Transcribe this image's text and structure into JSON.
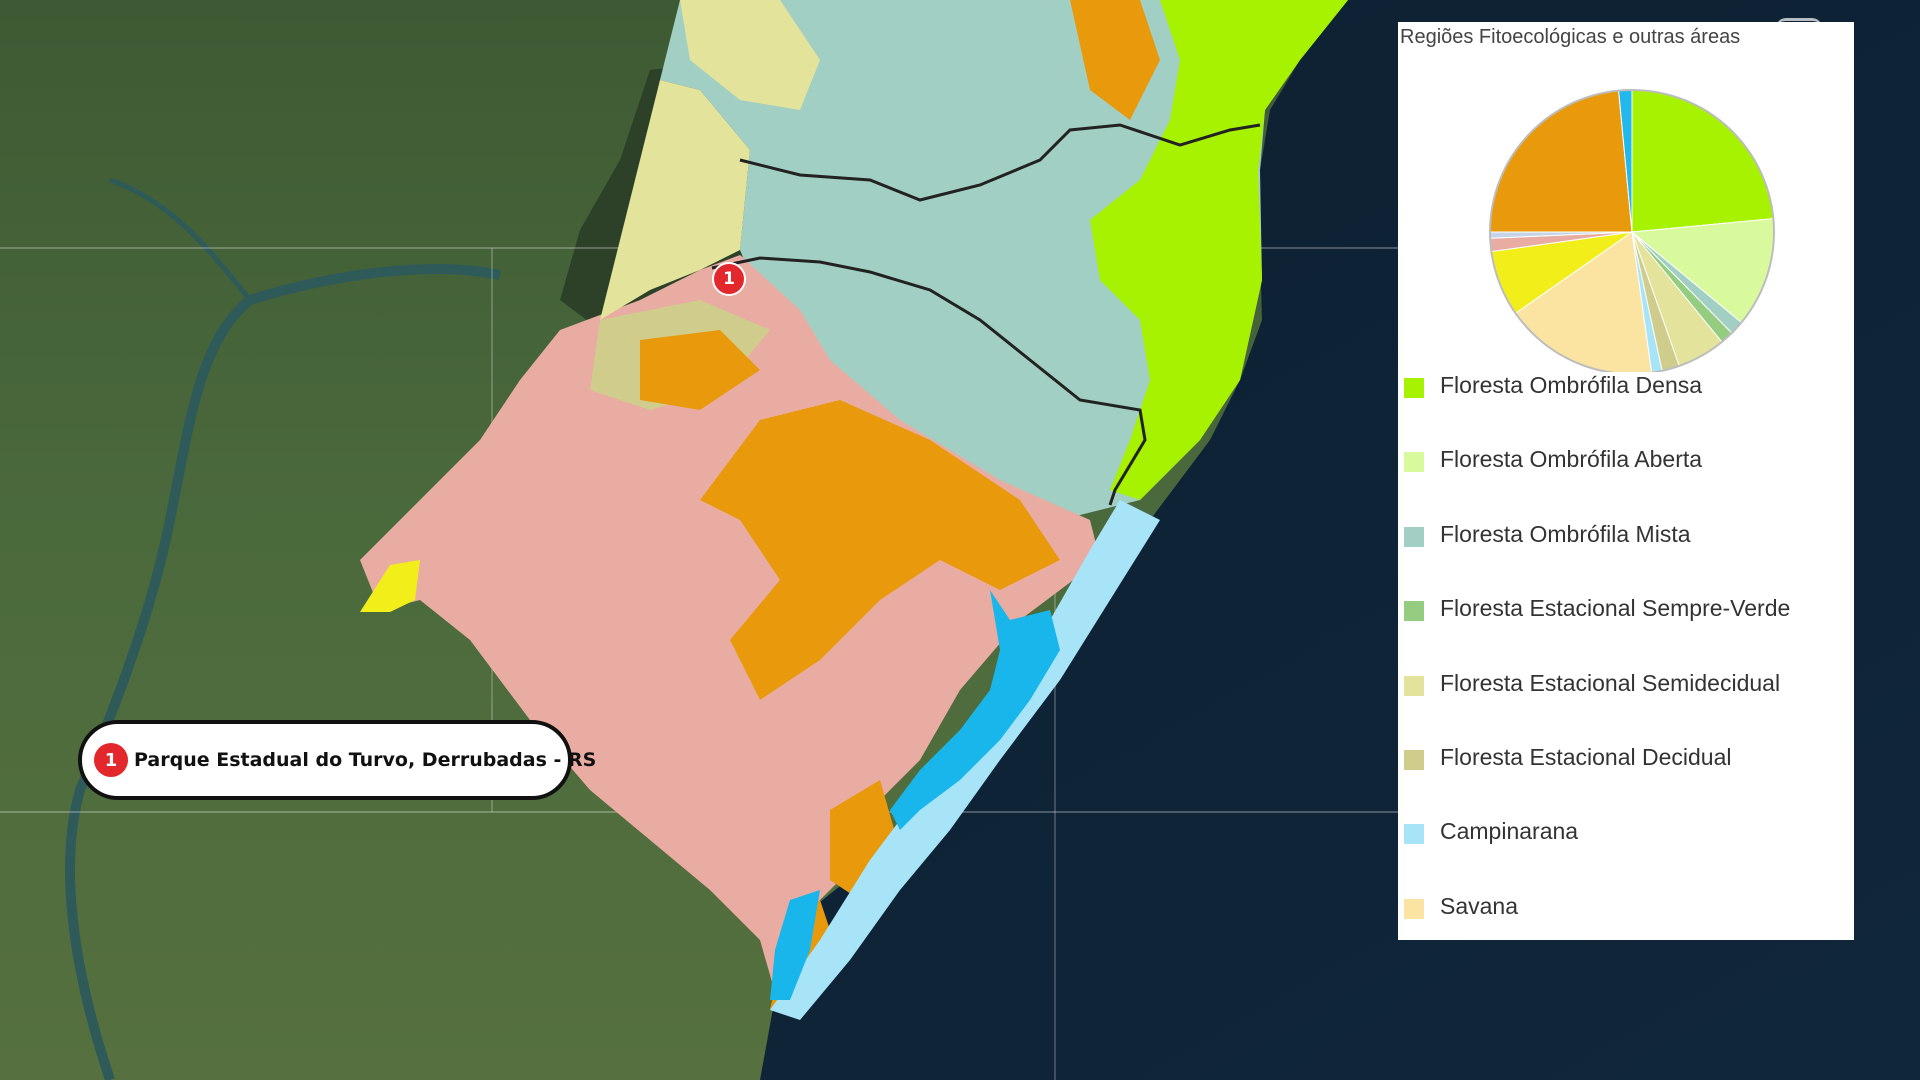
{
  "map": {
    "marker_label": "1",
    "callout": {
      "badge": "1",
      "text": "Parque Estadual do Turvo, Derrubadas - RS"
    }
  },
  "legend": {
    "title": "Regiões Fitoecológicas e outras áreas",
    "items": [
      {
        "label": "Floresta Ombrófila Densa",
        "color": "#a6f200"
      },
      {
        "label": "Floresta Ombrófila Aberta",
        "color": "#d9fa9c"
      },
      {
        "label": "Floresta Ombrófila Mista",
        "color": "#a2cfc3"
      },
      {
        "label": "Floresta Estacional Sempre-Verde",
        "color": "#94cc80"
      },
      {
        "label": "Floresta Estacional Semidecidual",
        "color": "#e3e39c"
      },
      {
        "label": "Floresta Estacional Decidual",
        "color": "#cfcc8c"
      },
      {
        "label": "Campinarana",
        "color": "#a8e4f8"
      },
      {
        "label": "Savana",
        "color": "#fbe3a2"
      }
    ]
  },
  "chart_data": {
    "type": "pie",
    "title": "Regiões Fitoecológicas e outras áreas",
    "slices": [
      {
        "label": "Floresta Ombrófila Densa",
        "value": 23.5,
        "color": "#a6f200"
      },
      {
        "label": "Floresta Ombrófila Aberta",
        "value": 12.5,
        "color": "#d9fa9c"
      },
      {
        "label": "Floresta Ombrófila Mista",
        "value": 1.6,
        "color": "#a2cfc3"
      },
      {
        "label": "Floresta Estacional Sempre-Verde",
        "value": 1.5,
        "color": "#94cc80"
      },
      {
        "label": "Floresta Estacional Semidecidual",
        "value": 5.5,
        "color": "#e3e39c"
      },
      {
        "label": "Floresta Estacional Decidual",
        "value": 2.0,
        "color": "#cfcc8c"
      },
      {
        "label": "Campinarana",
        "value": 1.2,
        "color": "#a8e4f8"
      },
      {
        "label": "Savana",
        "value": 17.5,
        "color": "#fbe3a2"
      },
      {
        "label": "",
        "value": 7.5,
        "color": "#f2ee1a"
      },
      {
        "label": "",
        "value": 1.5,
        "color": "#e9aca2"
      },
      {
        "label": "",
        "value": 0.7,
        "color": "#c6d4e8"
      },
      {
        "label": "",
        "value": 23.5,
        "color": "#e89a0c"
      },
      {
        "label": "",
        "value": 1.5,
        "color": "#22b8ec"
      }
    ]
  }
}
